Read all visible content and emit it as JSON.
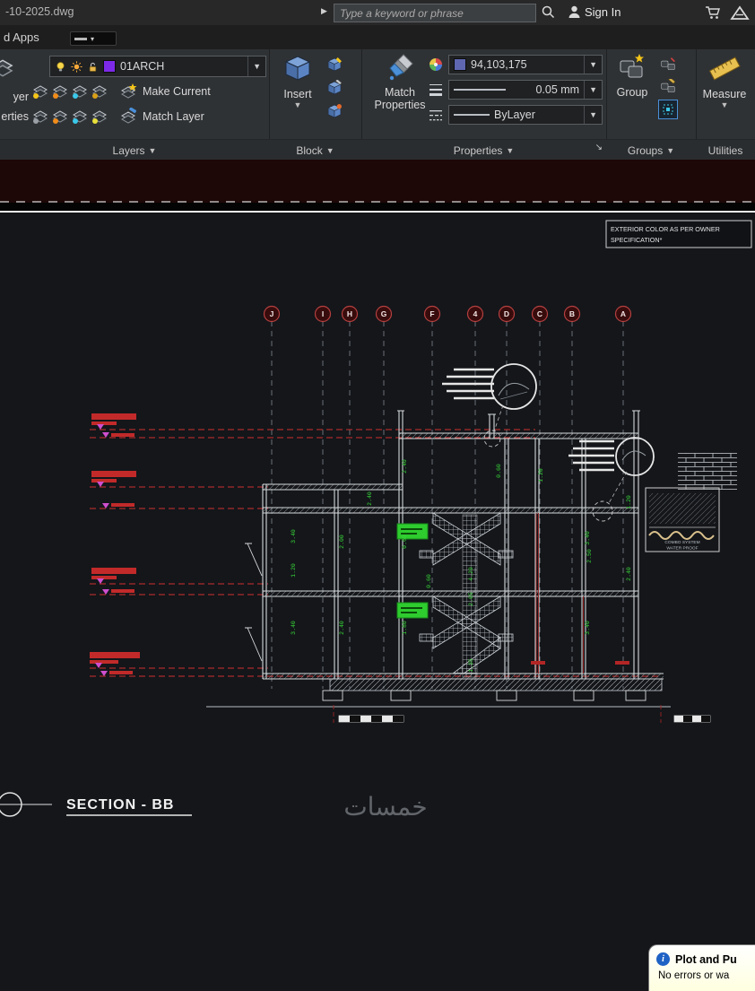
{
  "title_bar": {
    "filename": "-10-2025.dwg",
    "nav_arrow": "▶",
    "search_placeholder": "Type a keyword or phrase",
    "sign_in": "Sign In"
  },
  "app_bar": {
    "label": "d Apps"
  },
  "ribbon": {
    "left_cut": {
      "line1": "yer",
      "line2": "erties"
    },
    "layers": {
      "layer_name": "01ARCH",
      "make_current": "Make Current",
      "match_layer": "Match Layer",
      "panel_label": "Layers"
    },
    "block": {
      "insert": "Insert",
      "panel_label": "Block"
    },
    "properties": {
      "match_line1": "Match",
      "match_line2": "Properties",
      "color_value": "94,103,175",
      "lineweight_value": "0.05 mm",
      "linetype_value": "ByLayer",
      "panel_label": "Properties"
    },
    "groups": {
      "group_label": "Group",
      "panel_label": "Groups"
    },
    "utilities": {
      "measure_label": "Measure",
      "panel_label": "Utilities"
    }
  },
  "drawing": {
    "exterior_note_line1": "EXTERIOR COLOR AS PER OWNER",
    "exterior_note_line2": "SPECIFICATION*",
    "grid_bubbles": [
      "J",
      "I",
      "H",
      "G",
      "F",
      "4",
      "D",
      "C",
      "B",
      "A"
    ],
    "dims": [
      "3.40",
      "3.40",
      "1.20",
      "2.00",
      "2.40",
      "2.40",
      "2.40",
      "0.60",
      "1.80",
      "0.60",
      "4.20",
      "2.65",
      "1.35",
      "0.60",
      "1.20",
      "3.40",
      "3.40",
      "2.50",
      "1.20",
      "2.40"
    ],
    "detail_note_line1": "COMBO SYSTEM",
    "detail_note_line2": "WATER PROOF",
    "section_title": "SECTION - BB",
    "watermark": "خمسات"
  },
  "popup": {
    "title": "Plot and Pu",
    "body": "No errors or wa"
  },
  "colors": {
    "layer_swatch": "#7D2AE8",
    "color_value_swatch": "#5E67AF",
    "level_line_red": "#D03030",
    "marker_magenta": "#CF4FCF",
    "highlight_green": "#2ECC2E",
    "grid_bubble_red": "#B54040"
  }
}
